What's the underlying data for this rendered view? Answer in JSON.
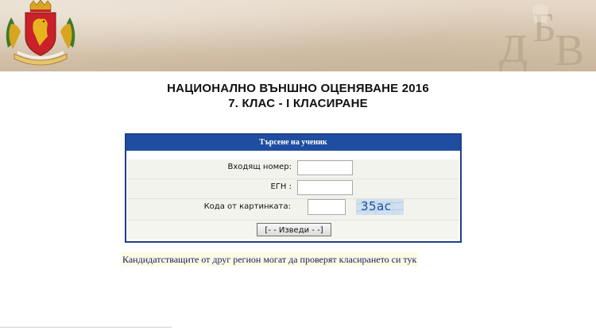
{
  "header": {
    "title_line1": "НАЦИОНАЛНО ВЪНШНО ОЦЕНЯВАНЕ 2016",
    "title_line2": "7. КЛАС - I КЛАСИРАНЕ"
  },
  "search": {
    "heading": "Търсене на ученик",
    "incoming_number_label": "Входящ номер:",
    "incoming_number_value": "",
    "egn_label": "ЕГН :",
    "egn_value": "",
    "captcha_label": "Кода от картинката:",
    "captcha_value": "",
    "captcha_image_text": "35ac",
    "submit_label": "[- - Изведи - -]"
  },
  "notice": {
    "text": "Кандидатстващите от друг регион могат да проверят класирането си тук"
  },
  "colors": {
    "panel_border": "#1f3f8c",
    "panel_header": "#1f4ea0",
    "notice_bg": "#fbfbe4"
  },
  "icons": [
    "bulgarian-coat-of-arms",
    "abv-logo"
  ]
}
